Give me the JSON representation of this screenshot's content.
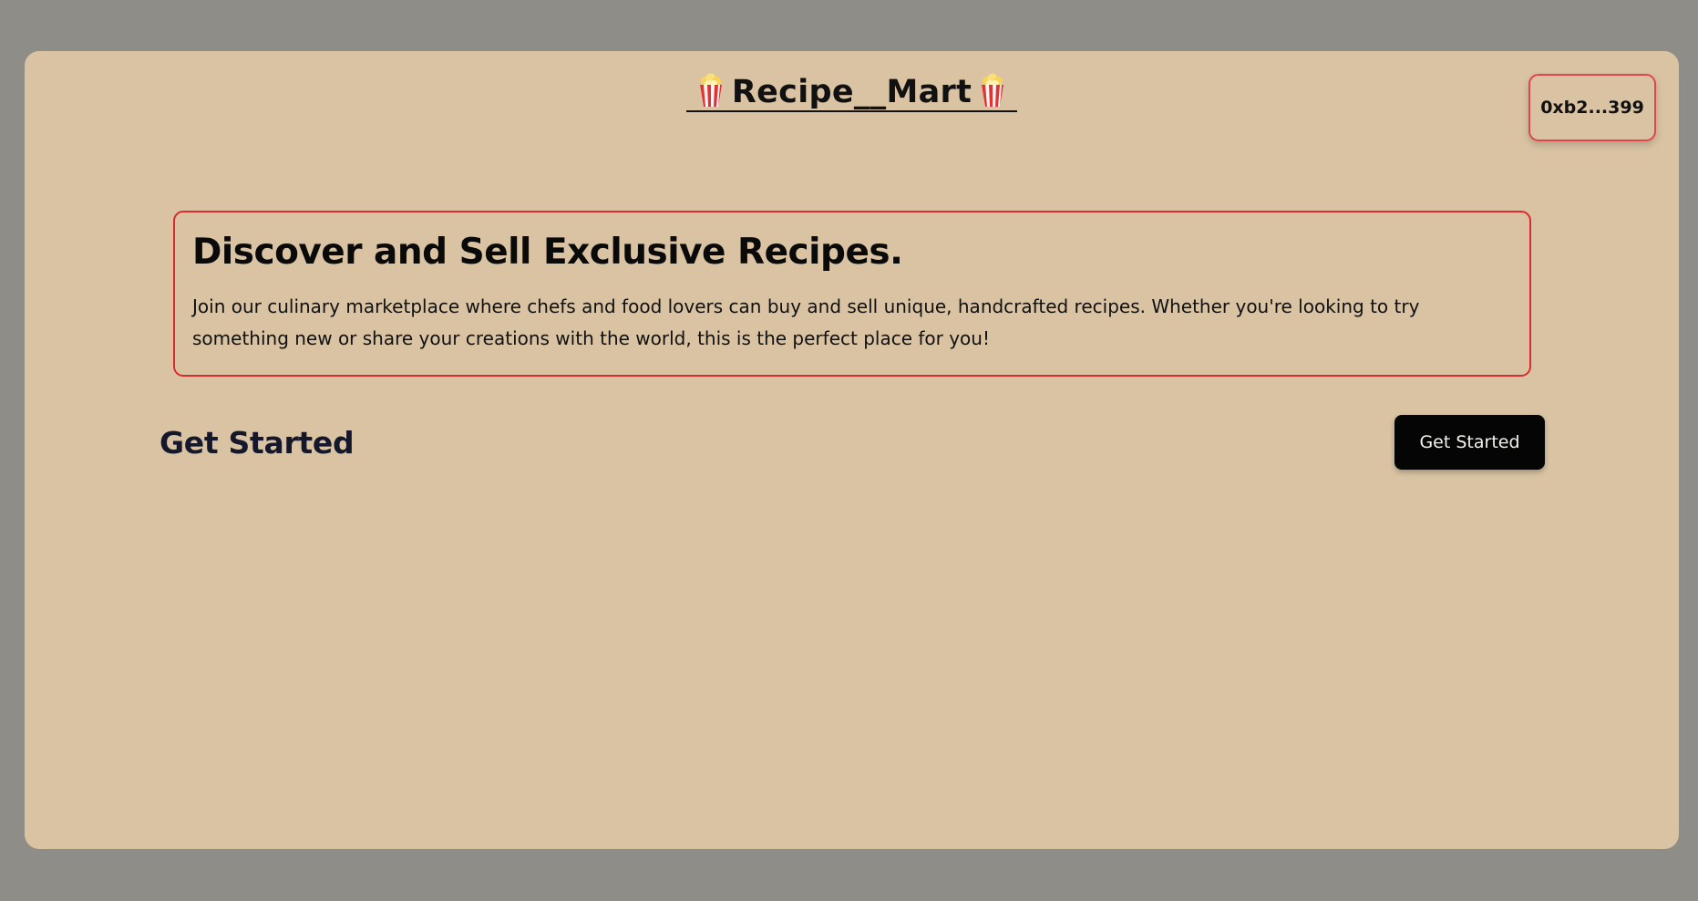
{
  "header": {
    "title": "Recipe__Mart",
    "left_icon": "popcorn-icon",
    "right_icon": "popcorn-icon"
  },
  "wallet": {
    "address_label": "0xb2...399"
  },
  "hero": {
    "heading": "Discover and Sell Exclusive Recipes.",
    "description": "Join our culinary marketplace where chefs and food lovers can buy and sell unique, handcrafted recipes. Whether you're looking to try something new or share your creations with the world, this is the perfect place for you!"
  },
  "get_started": {
    "heading": "Get Started",
    "button_label": "Get Started"
  },
  "colors": {
    "page_background": "#8e8d88",
    "card_background": "#d9c3a3",
    "accent_border": "#dc2b2f",
    "button_background": "#050505"
  }
}
